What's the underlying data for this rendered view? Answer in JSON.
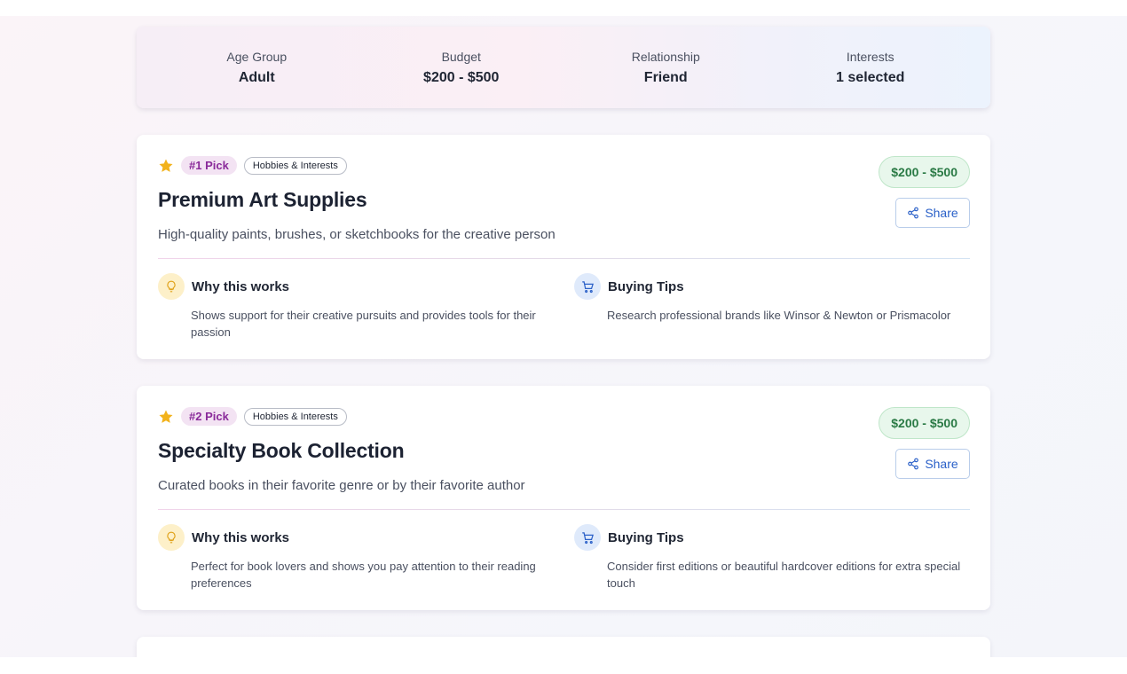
{
  "summary": {
    "items": [
      {
        "label": "Age Group",
        "value": "Adult"
      },
      {
        "label": "Budget",
        "value": "$200 - $500"
      },
      {
        "label": "Relationship",
        "value": "Friend"
      },
      {
        "label": "Interests",
        "value": "1 selected"
      }
    ]
  },
  "cards": [
    {
      "pick": "#1 Pick",
      "category": "Hobbies & Interests",
      "title": "Premium Art Supplies",
      "description": "High-quality paints, brushes, or sketchbooks for the creative person",
      "price": "$200 - $500",
      "share_label": "Share",
      "why_title": "Why this works",
      "why_text": "Shows support for their creative pursuits and provides tools for their passion",
      "tips_title": "Buying Tips",
      "tips_text": "Research professional brands like Winsor & Newton or Prismacolor"
    },
    {
      "pick": "#2 Pick",
      "category": "Hobbies & Interests",
      "title": "Specialty Book Collection",
      "description": "Curated books in their favorite genre or by their favorite author",
      "price": "$200 - $500",
      "share_label": "Share",
      "why_title": "Why this works",
      "why_text": "Perfect for book lovers and shows you pay attention to their reading preferences",
      "tips_title": "Buying Tips",
      "tips_text": "Consider first editions or beautiful hardcover editions for extra special touch"
    }
  ],
  "icons": {
    "star": "star-icon",
    "why": "lightbulb-icon",
    "tips": "shopping-cart-icon",
    "share": "share-icon"
  },
  "colors": {
    "star": "#f2b21b",
    "pick_text": "#8a2a9a",
    "price_text": "#2a7a45",
    "share_text": "#2a60c8"
  }
}
